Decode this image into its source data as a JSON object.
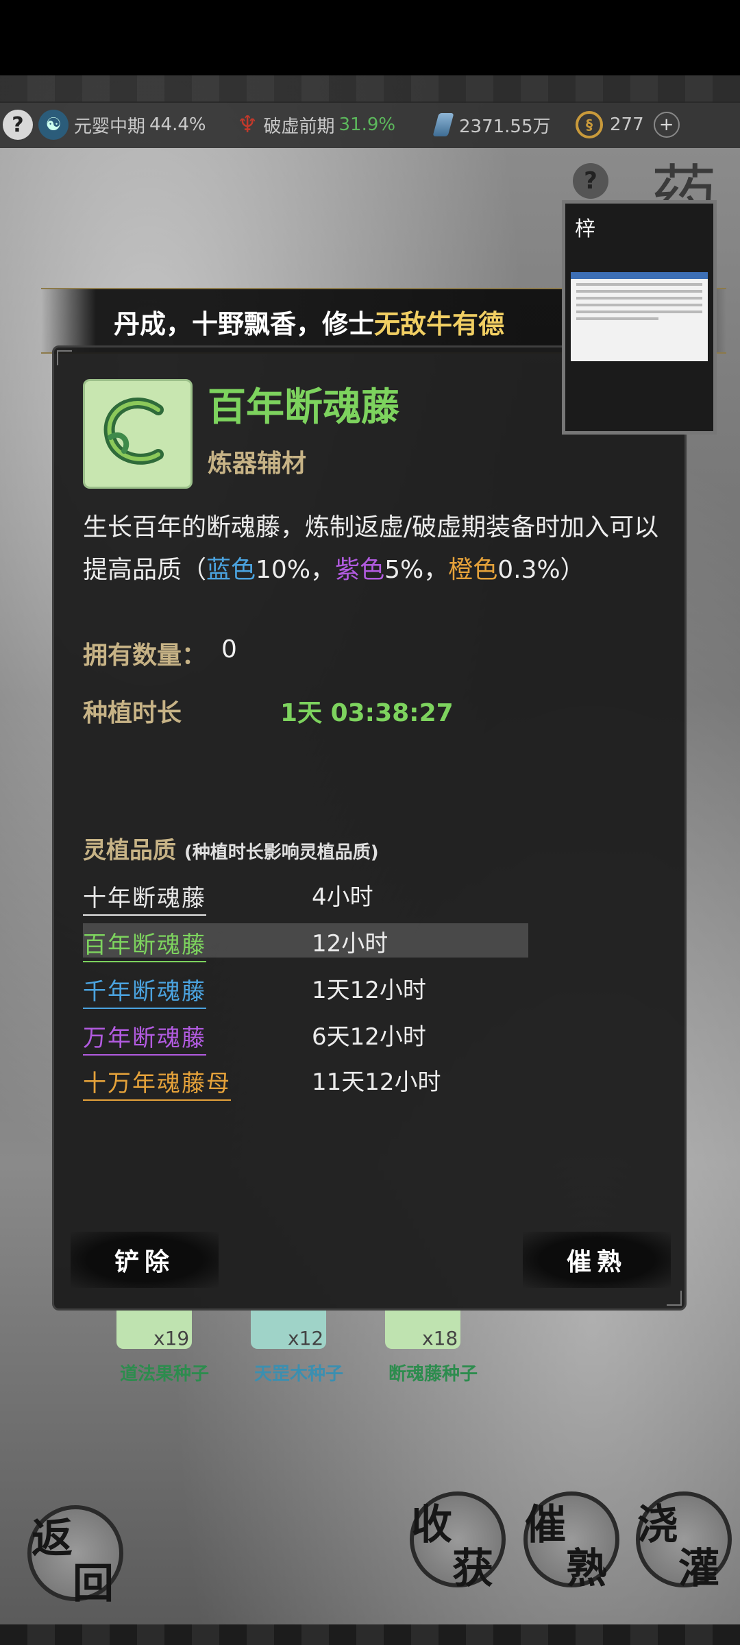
{
  "topbar": {
    "realm_label": "元婴中期",
    "realm_pct": "44.4%",
    "breakthrough_label": "破虚前期",
    "breakthrough_pct": "31.9%",
    "stones": "2371.55万",
    "coins": "277"
  },
  "page": {
    "corner_title": "药"
  },
  "ticker": {
    "prefix": "丹成，十野飘香，修士",
    "highlight": "无敌牛有德"
  },
  "overlay": {
    "label": "梓"
  },
  "item": {
    "name": "百年断魂藤",
    "type": "炼器辅材",
    "description": "生长百年的断魂藤，炼制返虚/破虚期装备时加入可以提高品质（",
    "blue_label": "蓝色",
    "blue_value": "10%，",
    "purple_label": "紫色",
    "purple_value": "5%，",
    "orange_label": "橙色",
    "orange_value": "0.3%）",
    "owned_label": "拥有数量：",
    "owned_value": "0",
    "grow_label": "种植时长",
    "grow_value": "1天 03:38:27"
  },
  "quality": {
    "title": "灵植品质",
    "note": "(种植时长影响灵植品质)",
    "rows": [
      {
        "name": "十年断魂藤",
        "time": "4小时",
        "color": "#e8e8e8"
      },
      {
        "name": "百年断魂藤",
        "time": "12小时",
        "color": "#7dd35e"
      },
      {
        "name": "千年断魂藤",
        "time": "1天12小时",
        "color": "#4ba3df"
      },
      {
        "name": "万年断魂藤",
        "time": "6天12小时",
        "color": "#b25be0"
      },
      {
        "name": "十万年魂藤母",
        "time": "11天12小时",
        "color": "#e5a23a"
      }
    ]
  },
  "buttons": {
    "remove": "铲除",
    "ripen": "催熟"
  },
  "seeds": [
    {
      "name": "道法果种子",
      "count": "x19"
    },
    {
      "name": "天罡木种子",
      "count": "x12"
    },
    {
      "name": "断魂藤种子",
      "count": "x18"
    }
  ],
  "actions": {
    "back_1": "返",
    "back_2": "回",
    "harvest_1": "收",
    "harvest_2": "获",
    "ripen_1": "催",
    "ripen_2": "熟",
    "water_1": "浇",
    "water_2": "灌"
  },
  "colors": {
    "accent_green": "#7dd35e",
    "gold": "#c7b386",
    "ticker_highlight": "#f1cf63"
  }
}
